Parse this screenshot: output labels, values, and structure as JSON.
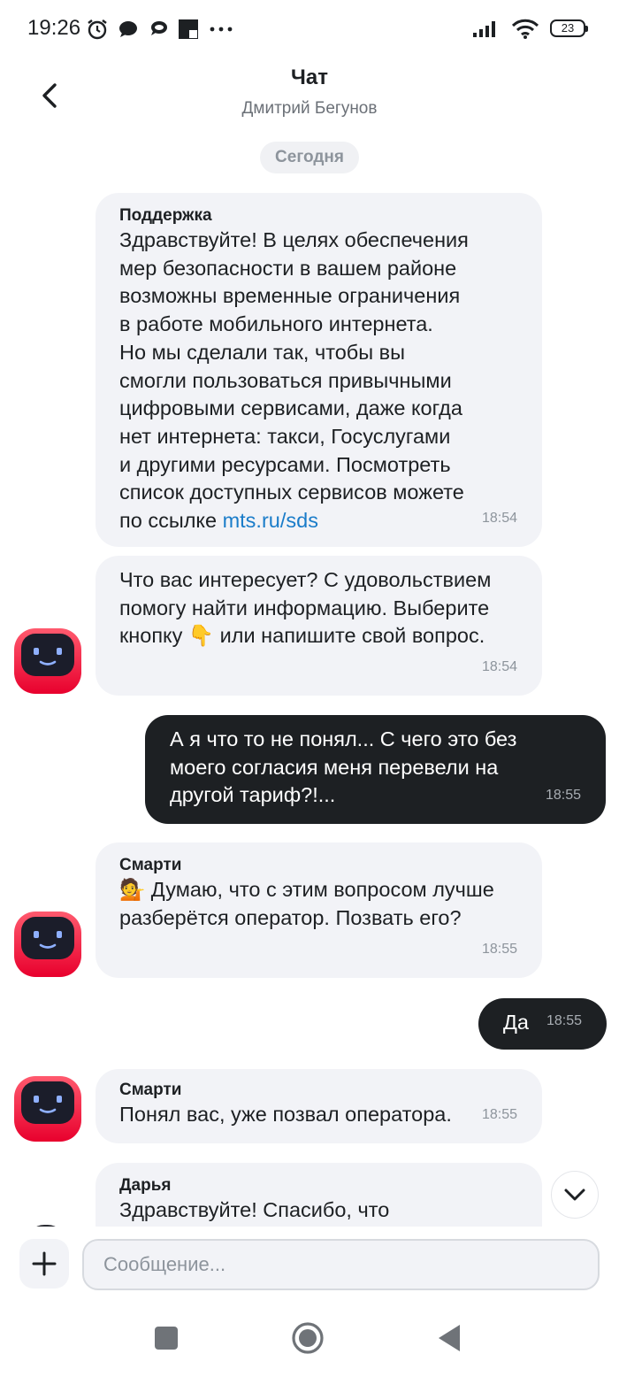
{
  "status_bar": {
    "time": "19:26",
    "battery": "23"
  },
  "header": {
    "title": "Чат",
    "subtitle": "Дмитрий Бегунов"
  },
  "date_separator": "Сегодня",
  "messages": [
    {
      "sender": "Поддержка",
      "lines": [
        "Здравствуйте! В целях обеспечения",
        "мер безопасности в вашем районе",
        "возможны временные ограничения",
        "в работе мобильного интернета.",
        "Но мы сделали так, чтобы вы",
        "смогли пользоваться привычными",
        "цифровыми сервисами, даже когда",
        "нет интернета: такси, Госуслугами",
        "и другими ресурсами. Посмотреть",
        "список доступных сервисов можете"
      ],
      "last_line_prefix": "по ссылке ",
      "link": "mts.ru/sds",
      "time": "18:54"
    },
    {
      "lines": [
        "Что вас интересует? С удовольствием",
        "помогу найти информацию. Выберите",
        "кнопку 👇 или напишите свой вопрос."
      ],
      "time": "18:54"
    },
    {
      "lines": [
        "А я что то не понял... С чего это без",
        "моего согласия меня перевели на",
        "другой тариф?!..."
      ],
      "time": "18:55"
    },
    {
      "sender": "Смарти",
      "lines": [
        "💁 Думаю, что с этим вопросом лучше",
        "разберётся оператор. Позвать его?"
      ],
      "time": "18:55"
    },
    {
      "text": "Да",
      "time": "18:55"
    },
    {
      "sender": "Смарти",
      "text": "Понял вас, уже позвал оператора.",
      "time": "18:55"
    },
    {
      "sender": "Дарья",
      "lines": [
        "Здравствуйте! Спасибо, что"
      ]
    }
  ],
  "input": {
    "placeholder": "Сообщение..."
  },
  "icons": {
    "back": "chevron-left-icon",
    "scroll": "chevron-down-icon",
    "add": "plus-icon",
    "nav": [
      "square-icon",
      "circle-icon",
      "triangle-icon"
    ]
  },
  "colors": {
    "incoming_bubble": "#f2f3f7",
    "outgoing_bubble": "#1d2023",
    "link": "#1a7cc9",
    "bot_avatar": "#ff0032"
  }
}
